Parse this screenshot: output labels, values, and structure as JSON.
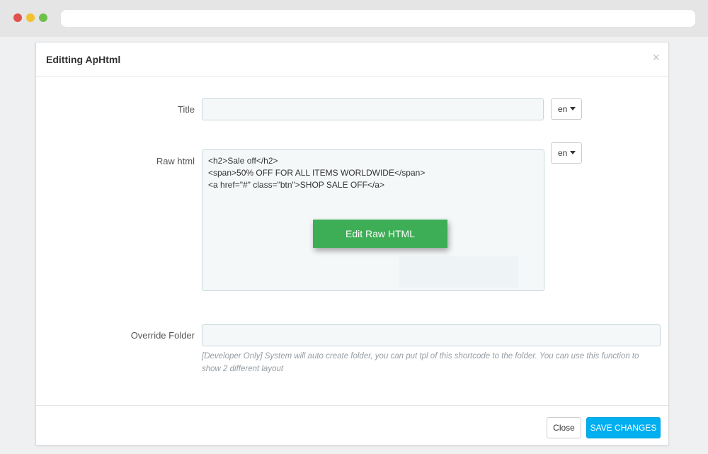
{
  "window": {
    "dots": [
      "red",
      "yellow",
      "green"
    ]
  },
  "modal": {
    "title": "Editting ApHtml",
    "close_glyph": "×",
    "fields": {
      "title": {
        "label": "Title",
        "value": "",
        "lang": "en"
      },
      "raw_html": {
        "label": "Raw html",
        "lang": "en",
        "lines": [
          "<h2>Sale off</h2>",
          "<span>50% OFF FOR ALL ITEMS WORLDWIDE</span>",
          "<a href=\"#\" class=\"btn\">SHOP SALE OFF</a>"
        ],
        "edit_button": "Edit Raw HTML"
      },
      "override_folder": {
        "label": "Override Folder",
        "value": "",
        "help": "[Developer Only] System will auto create folder, you can put tpl of this shortcode to the folder. You can use this function to show 2 different layout"
      }
    },
    "footer": {
      "close_label": "Close",
      "save_label": "SAVE CHANGES"
    }
  },
  "colors": {
    "accent_green": "#3dae55",
    "accent_blue": "#00aff0"
  }
}
